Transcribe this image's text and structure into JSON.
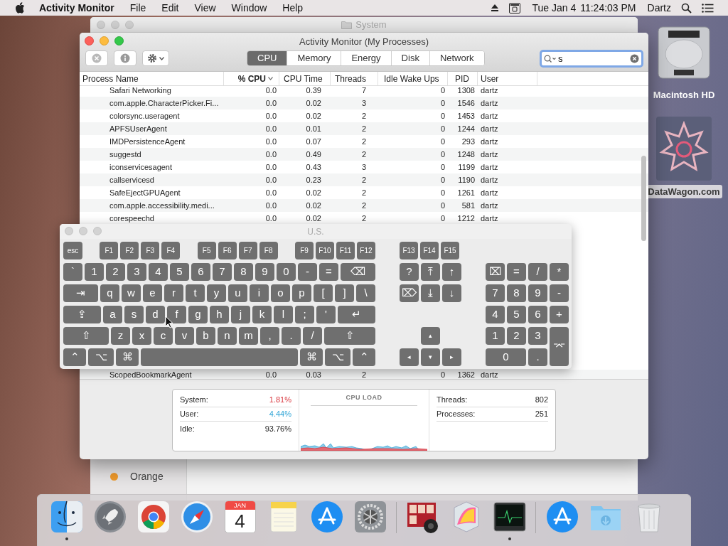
{
  "menu_bar": {
    "app_name": "Activity Monitor",
    "menus": [
      "File",
      "Edit",
      "View",
      "Window",
      "Help"
    ],
    "date": "Tue Jan 4",
    "time": "11:24:03 PM",
    "user": "Dartz"
  },
  "background_window": {
    "title": "System",
    "sidebar_items": [
      {
        "label": "Orange",
        "color": "#f09a2c"
      }
    ]
  },
  "window": {
    "title": "Activity Monitor (My Processes)",
    "tabs": [
      {
        "label": "CPU",
        "selected": true
      },
      {
        "label": "Memory",
        "selected": false
      },
      {
        "label": "Energy",
        "selected": false
      },
      {
        "label": "Disk",
        "selected": false
      },
      {
        "label": "Network",
        "selected": false
      }
    ],
    "search": {
      "value": "s"
    },
    "table": {
      "columns": [
        {
          "label": "Process Name",
          "sorted": false
        },
        {
          "label": "% CPU",
          "sorted": true
        },
        {
          "label": "CPU Time",
          "sorted": false
        },
        {
          "label": "Threads",
          "sorted": false
        },
        {
          "label": "Idle Wake Ups",
          "sorted": false
        },
        {
          "label": "PID",
          "sorted": false
        },
        {
          "label": "User",
          "sorted": false
        }
      ],
      "rows": [
        [
          "Safari Networking",
          "0.0",
          "0.39",
          "7",
          "0",
          "1308",
          "dartz"
        ],
        [
          "com.apple.CharacterPicker.Fi...",
          "0.0",
          "0.02",
          "3",
          "0",
          "1546",
          "dartz"
        ],
        [
          "colorsync.useragent",
          "0.0",
          "0.02",
          "2",
          "0",
          "1453",
          "dartz"
        ],
        [
          "APFSUserAgent",
          "0.0",
          "0.01",
          "2",
          "0",
          "1244",
          "dartz"
        ],
        [
          "IMDPersistenceAgent",
          "0.0",
          "0.07",
          "2",
          "0",
          "293",
          "dartz"
        ],
        [
          "suggestd",
          "0.0",
          "0.49",
          "2",
          "0",
          "1248",
          "dartz"
        ],
        [
          "iconservicesagent",
          "0.0",
          "0.43",
          "3",
          "0",
          "1199",
          "dartz"
        ],
        [
          "callservicesd",
          "0.0",
          "0.23",
          "2",
          "0",
          "1190",
          "dartz"
        ],
        [
          "SafeEjectGPUAgent",
          "0.0",
          "0.02",
          "2",
          "0",
          "1261",
          "dartz"
        ],
        [
          "com.apple.accessibility.medi...",
          "0.0",
          "0.02",
          "2",
          "0",
          "581",
          "dartz"
        ],
        [
          "corespeechd",
          "0.0",
          "0.02",
          "2",
          "0",
          "1212",
          "dartz"
        ],
        [
          "ScopedBookmarkAgent",
          "0.0",
          "0.03",
          "2",
          "0",
          "1362",
          "dartz"
        ]
      ]
    },
    "summary": {
      "stats": [
        {
          "label": "System:",
          "value": "1.81%",
          "color": "#d9383f"
        },
        {
          "label": "User:",
          "value": "4.44%",
          "color": "#2fa4d6"
        },
        {
          "label": "Idle:",
          "value": "93.76%",
          "color": "#262626"
        }
      ],
      "chart_title": "CPU LOAD",
      "counts": [
        {
          "label": "Threads:",
          "value": "802"
        },
        {
          "label": "Processes:",
          "value": "251"
        }
      ]
    }
  },
  "keyboard_viewer": {
    "title": "U.S.",
    "function_keys": [
      [
        "esc"
      ],
      [
        "F1",
        "F2",
        "F3",
        "F4"
      ],
      [
        "F5",
        "F6",
        "F7",
        "F8"
      ],
      [
        "F9",
        "F10",
        "F11",
        "F12"
      ]
    ],
    "main_rows": [
      [
        "`",
        "1",
        "2",
        "3",
        "4",
        "5",
        "6",
        "7",
        "8",
        "9",
        "0",
        "-",
        "=",
        {
          "label": "⌫",
          "kind": "grow"
        }
      ],
      [
        {
          "label": "⇥",
          "kind": "grow"
        },
        "q",
        "w",
        "e",
        "r",
        "t",
        "y",
        "u",
        "i",
        "o",
        "p",
        "[",
        "]",
        "\\"
      ],
      [
        {
          "label": "⇪",
          "kind": "caps"
        },
        "a",
        "s",
        "d",
        "f",
        "g",
        "h",
        "j",
        "k",
        "l",
        ";",
        "'",
        {
          "label": "↵",
          "kind": "grow"
        }
      ],
      [
        {
          "label": "⇧",
          "kind": "shift"
        },
        "z",
        "x",
        "c",
        "v",
        "b",
        "n",
        "m",
        ",",
        ".",
        "/",
        {
          "label": "⇧",
          "kind": "grow"
        }
      ],
      [
        {
          "label": "⌃",
          "kind": "mod"
        },
        {
          "label": "⌥",
          "kind": "opt"
        },
        {
          "label": "⌘",
          "kind": "mod"
        },
        {
          "kind": "space"
        },
        {
          "label": "⌘",
          "kind": "mod"
        },
        {
          "label": "⌥",
          "kind": "opt"
        },
        {
          "label": "⌃",
          "kind": "mod"
        }
      ]
    ],
    "nav_rows": [
      [
        "F13",
        "F14",
        "F15"
      ],
      [
        "?",
        "⤒",
        "↑"
      ],
      [
        "⌦",
        "⤓",
        "↓"
      ]
    ],
    "arrow_rows": [
      [
        "▴"
      ],
      [
        "◂",
        "▾",
        "▸"
      ]
    ],
    "numpad": [
      {
        "label": "⌧",
        "kind": "key"
      },
      {
        "label": "=",
        "kind": "key"
      },
      {
        "label": "/",
        "kind": "key"
      },
      {
        "label": "*",
        "kind": "key"
      },
      {
        "label": "7",
        "kind": "key"
      },
      {
        "label": "8",
        "kind": "key"
      },
      {
        "label": "9",
        "kind": "key"
      },
      {
        "label": "-",
        "kind": "key"
      },
      {
        "label": "4",
        "kind": "key"
      },
      {
        "label": "5",
        "kind": "key"
      },
      {
        "label": "6",
        "kind": "key"
      },
      {
        "label": "+",
        "kind": "key"
      },
      {
        "label": "1",
        "kind": "key"
      },
      {
        "label": "2",
        "kind": "key"
      },
      {
        "label": "3",
        "kind": "key"
      },
      {
        "label": "⌤",
        "kind": "tall"
      },
      {
        "label": "0",
        "kind": "wide"
      },
      {
        "label": ".",
        "kind": "key"
      }
    ]
  },
  "desktop_icons": [
    {
      "label": "Macintosh HD",
      "kind": "disk"
    },
    {
      "label": "DataWagon.com",
      "kind": "image"
    }
  ],
  "dock": {
    "items": [
      {
        "kind": "finder",
        "running": true
      },
      {
        "kind": "rocket",
        "running": false
      },
      {
        "kind": "chrome",
        "running": false
      },
      {
        "kind": "compass",
        "running": false
      },
      {
        "kind": "calendar",
        "month": "JAN",
        "day": "4",
        "running": false
      },
      {
        "kind": "notes",
        "running": false
      },
      {
        "kind": "appstore",
        "running": false
      },
      {
        "kind": "gears",
        "running": false
      },
      {
        "kind": "separator"
      },
      {
        "kind": "photos",
        "running": false
      },
      {
        "kind": "grapher",
        "running": false
      },
      {
        "kind": "monitor",
        "running": true
      },
      {
        "kind": "separator"
      },
      {
        "kind": "appstore",
        "running": false
      },
      {
        "kind": "folder",
        "running": false
      },
      {
        "kind": "trash",
        "running": false
      }
    ]
  }
}
